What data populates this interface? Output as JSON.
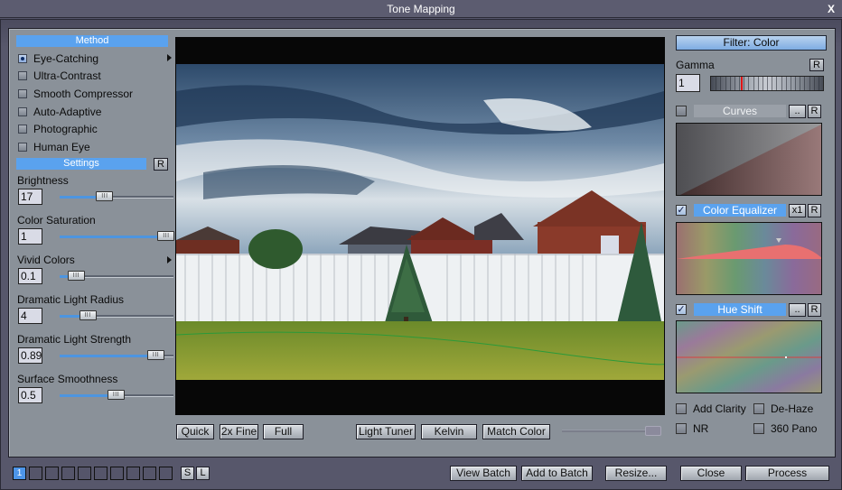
{
  "window": {
    "title": "Tone Mapping",
    "close_label": "X"
  },
  "method": {
    "header": "Method",
    "items": [
      {
        "label": "Eye-Catching",
        "selected": true,
        "has_submenu": true
      },
      {
        "label": "Ultra-Contrast",
        "selected": false,
        "has_submenu": false
      },
      {
        "label": "Smooth Compressor",
        "selected": false,
        "has_submenu": false
      },
      {
        "label": "Auto-Adaptive",
        "selected": false,
        "has_submenu": false
      },
      {
        "label": "Photographic",
        "selected": false,
        "has_submenu": false
      },
      {
        "label": "Human Eye",
        "selected": false,
        "has_submenu": false
      }
    ]
  },
  "settings": {
    "header": "Settings",
    "reset_label": "R",
    "params": [
      {
        "label": "Brightness",
        "value": "17",
        "fraction": 0.4
      },
      {
        "label": "Color Saturation",
        "value": "1",
        "fraction": 0.94
      },
      {
        "label": "Vivid Colors",
        "value": "0.1",
        "fraction": 0.15,
        "has_submenu": true
      },
      {
        "label": "Dramatic Light Radius",
        "value": "4",
        "fraction": 0.25
      },
      {
        "label": "Dramatic Light Strength",
        "value": "0.89",
        "fraction": 0.85
      },
      {
        "label": "Surface Smoothness",
        "value": "0.5",
        "fraction": 0.5
      }
    ]
  },
  "preview": {
    "quality_buttons": [
      "Quick",
      "2x Fine",
      "Full"
    ],
    "tool_buttons": [
      "Light Tuner",
      "Kelvin",
      "Match Color"
    ],
    "zoom_fraction": 1.0
  },
  "filter": {
    "title": "Filter: Color",
    "gamma": {
      "label": "Gamma",
      "value": "1",
      "reset_label": "R",
      "marker_fraction": 0.27
    },
    "curves": {
      "label": "Curves",
      "enabled": false,
      "more_label": "..",
      "reset_label": "R"
    },
    "color_equalizer": {
      "label": "Color Equalizer",
      "enabled": true,
      "scale_label": "x1",
      "reset_label": "R"
    },
    "hue_shift": {
      "label": "Hue Shift",
      "enabled": true,
      "more_label": "..",
      "reset_label": "R"
    },
    "options": [
      {
        "label": "Add Clarity",
        "checked": false
      },
      {
        "label": "De-Haze",
        "checked": false
      },
      {
        "label": "NR",
        "checked": false
      },
      {
        "label": "360 Pano",
        "checked": false
      }
    ],
    "colors": {
      "accent": "#5aa2ee",
      "gamma_marker": "#e01515",
      "equalizer_curve": "#e86a6a"
    }
  },
  "footer": {
    "slots": [
      "1",
      "",
      "",
      "",
      "",
      "",
      "",
      "",
      "",
      ""
    ],
    "active_slot": 0,
    "save_label": "S",
    "load_label": "L",
    "buttons": {
      "view_batch": "View Batch",
      "add_to_batch": "Add to Batch",
      "resize": "Resize...",
      "close": "Close",
      "process": "Process"
    }
  }
}
